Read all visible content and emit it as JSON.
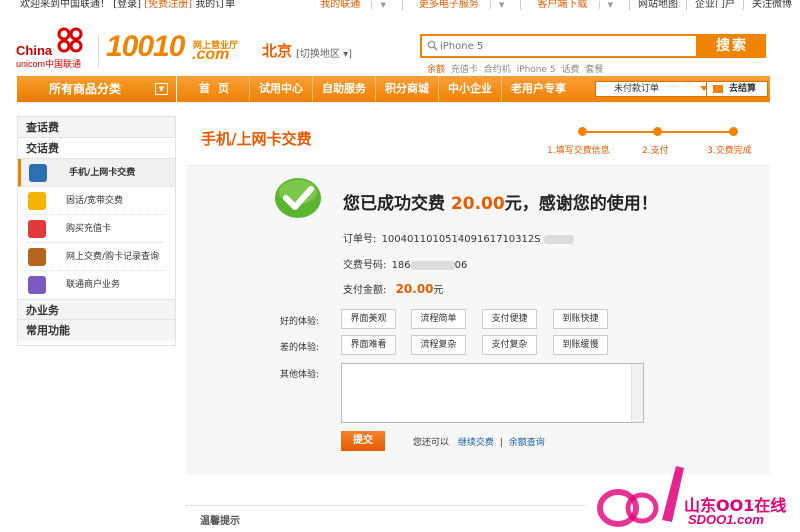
{
  "topbar": {
    "welcome": "欢迎来到中国联通！",
    "login": "[登录]",
    "register": "[免费注册]",
    "my_orders": "我的订单",
    "links": [
      "我的联通",
      "更多电子服务",
      "客户端下载",
      "网站地图",
      "企业门户",
      "关注微博"
    ]
  },
  "header": {
    "logo_en_line1": "China",
    "logo_en_line2": "unicom中国联通",
    "brand": "10010",
    "brand_sub1": "网上营业厅",
    "brand_sub2": ".com",
    "city": "北京",
    "city_switch": "[切换地区 ▾]",
    "search_placeholder": "iPhone 5",
    "search_button": "搜索",
    "hot_words": [
      "余额",
      "充值卡",
      "合约机",
      "iPhone 5",
      "话费",
      "套餐"
    ]
  },
  "nav": {
    "all_categories": "所有商品分类",
    "items": [
      "首页",
      "试用中心",
      "自助服务",
      "积分商城",
      "中小企业",
      "老用户专享"
    ],
    "unpaid_orders": "未付款订单",
    "checkout": "去结算"
  },
  "sidebar": {
    "sections": [
      {
        "title": "查话费"
      },
      {
        "title": "交话费"
      }
    ],
    "items": [
      {
        "label": "手机/上网卡交费",
        "icon": "mobile-icon",
        "color": "#f4b400"
      },
      {
        "label": "固话/宽带交费",
        "icon": "phone-icon",
        "color": "#f4b400"
      },
      {
        "label": "购买充值卡",
        "icon": "card-icon",
        "color": "#e23a3a"
      },
      {
        "label": "网上交费/购卡记录查询",
        "icon": "record-icon",
        "color": "#b5651d"
      },
      {
        "label": "联通商户业务",
        "icon": "merchant-icon",
        "color": "#7a5cc0"
      }
    ],
    "bottom_sections": [
      "办业务",
      "常用功能"
    ]
  },
  "main": {
    "title": "手机/上网卡交费",
    "steps": [
      "1.填写交费信息",
      "2.支付",
      "3.交费完成"
    ],
    "success_prefix": "您已成功交费",
    "success_amount": "20.00",
    "success_suffix": "元，感谢您的使用！",
    "order_label": "订单号:",
    "order_value": "100401101051409161710312S",
    "phone_label": "交费号码:",
    "phone_prefix": "186",
    "phone_suffix": "06",
    "pay_label": "支付金额:",
    "pay_amount": "20.00",
    "pay_unit": "元",
    "good_label": "好的体验:",
    "good_options": [
      "界面美观",
      "流程简单",
      "支付便捷",
      "到账快捷"
    ],
    "bad_label": "差的体验:",
    "bad_options": [
      "界面难看",
      "流程复杂",
      "支付复杂",
      "到账缓慢"
    ],
    "other_label": "其他体验:",
    "submit": "提交",
    "also_can": "您还可以",
    "link_continue": "继续交费",
    "separator": "|",
    "link_balance": "余额查询",
    "tips_title": "温馨提示"
  },
  "watermark": {
    "line1": "山东OO1在线",
    "line2": "SDOO1.com"
  },
  "colors": {
    "brand_orange": "#f08300",
    "title_orange": "#e85b00",
    "link_blue": "#1a5ea8",
    "success_green": "#5cb531"
  }
}
